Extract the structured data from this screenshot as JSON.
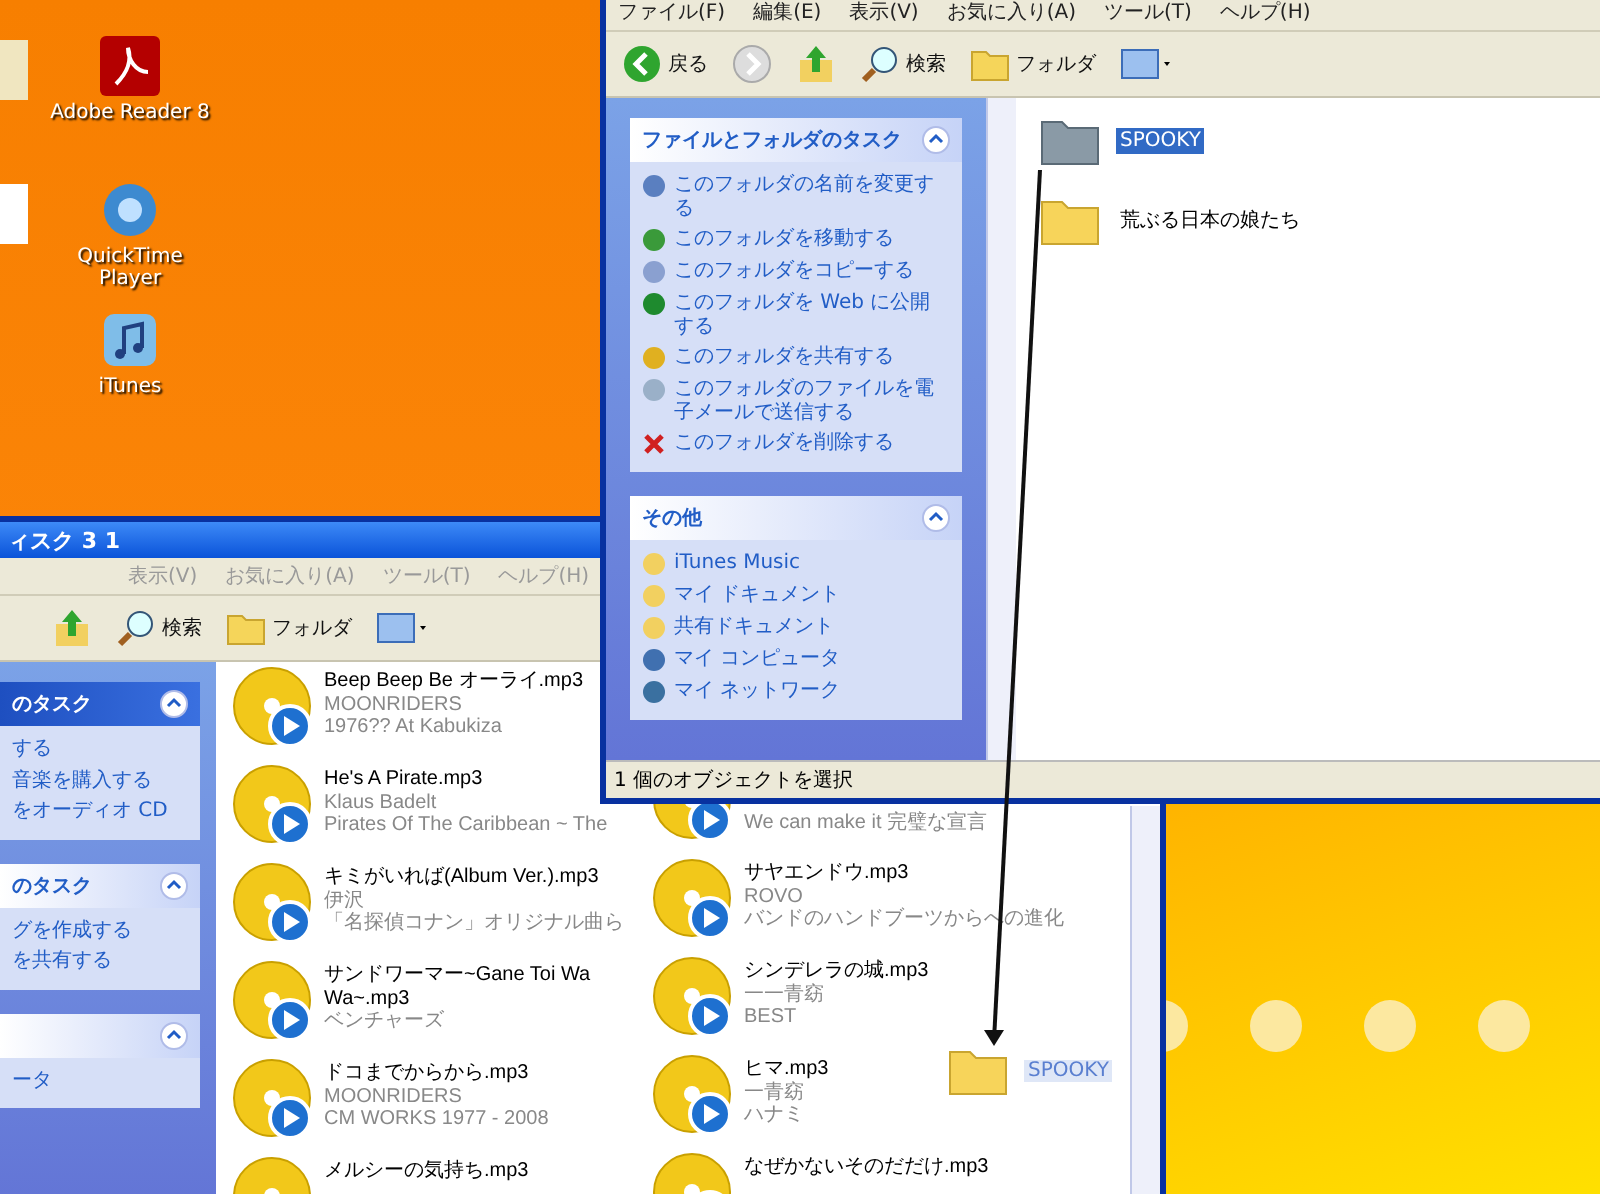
{
  "desktop": {
    "icons": [
      {
        "kind": "pdf",
        "label": "Adobe Reader 8"
      },
      {
        "kind": "quicktime",
        "label": "QuickTime Player"
      },
      {
        "kind": "itunes",
        "label": "iTunes"
      }
    ]
  },
  "front_window": {
    "menu": [
      "ファイル(F)",
      "編集(E)",
      "表示(V)",
      "お気に入り(A)",
      "ツール(T)",
      "ヘルプ(H)"
    ],
    "toolbar": [
      {
        "kind": "back",
        "label": "戻る"
      },
      {
        "kind": "forward"
      },
      {
        "kind": "up"
      },
      {
        "kind": "search",
        "label": "検索"
      },
      {
        "kind": "folders",
        "label": "フォルダ"
      },
      {
        "kind": "views"
      }
    ],
    "panels": [
      {
        "title": "ファイルとフォルダのタスク",
        "items": [
          {
            "kind": "rename",
            "label": "このフォルダの名前を変更する"
          },
          {
            "kind": "move",
            "label": "このフォルダを移動する"
          },
          {
            "kind": "copy",
            "label": "このフォルダをコピーする"
          },
          {
            "kind": "web",
            "label": "このフォルダを Web に公開する"
          },
          {
            "kind": "share",
            "label": "このフォルダを共有する"
          },
          {
            "kind": "mail",
            "label": "このフォルダのファイルを電子メールで送信する"
          },
          {
            "kind": "delete",
            "label": "このフォルダを削除する"
          }
        ]
      },
      {
        "title": "その他",
        "items": [
          {
            "kind": "folder",
            "label": "iTunes Music"
          },
          {
            "kind": "folder",
            "label": "マイ ドキュメント"
          },
          {
            "kind": "folder",
            "label": "共有ドキュメント"
          },
          {
            "kind": "computer",
            "label": "マイ コンピュータ"
          },
          {
            "kind": "network",
            "label": "マイ ネットワーク"
          }
        ]
      }
    ],
    "files": [
      {
        "name": "SPOOKY",
        "selected": true
      },
      {
        "name": "荒ぶる日本の娘たち",
        "selected": false
      }
    ],
    "status": "1 個のオブジェクトを選択"
  },
  "back_window": {
    "title": "ィスク 3 1",
    "menu": [
      "表示(V)",
      "お気に入り(A)",
      "ツール(T)",
      "ヘルプ(H)"
    ],
    "toolbar": [
      {
        "kind": "up"
      },
      {
        "kind": "search",
        "label": "検索"
      },
      {
        "kind": "folders",
        "label": "フォルダ"
      },
      {
        "kind": "views"
      }
    ],
    "panels": [
      {
        "title": "のタスク",
        "items": [
          "する",
          "音楽を購入する",
          "をオーディオ CD"
        ]
      },
      {
        "title": "のタスク",
        "items": [
          "グを作成する",
          "を共有する"
        ]
      },
      {
        "items": [
          "ータ"
        ]
      }
    ],
    "columns": [
      [
        {
          "title": "Beep Beep Be オーライ.mp3",
          "artist": "MOONRIDERS",
          "album": "1976?? At Kabukiza"
        },
        {
          "title": "He's A Pirate.mp3",
          "artist": "Klaus Badelt",
          "album": "Pirates Of The Caribbean ~ The"
        },
        {
          "title": "キミがいれば(Album Ver.).mp3",
          "artist": "伊沢",
          "album": "「名探偵コナン」オリジナル曲ら"
        },
        {
          "title": "サンドワーマー~Gane Toi Wa Wa~.mp3",
          "artist": "ベンチャーズ"
        },
        {
          "title": "ドコまでからから.mp3",
          "artist": "MOONRIDERS",
          "album": "CM WORKS 1977 - 2008"
        },
        {
          "title": "メルシーの気持ち.mp3"
        }
      ],
      [
        {
          "album": "We can make it 完璧な宣言"
        },
        {
          "title": "サヤエンドウ.mp3",
          "artist": "ROVO",
          "album": "バンドのハンドブーツからへの進化"
        },
        {
          "title": "シンデレラの城.mp3",
          "artist": "一一青窈",
          "album": "BEST"
        },
        {
          "title": "ヒマ.mp3",
          "artist": "一青窈",
          "album": "ハナミ"
        },
        {
          "title": "なぜかないそのだだけ.mp3"
        }
      ]
    ]
  },
  "drag": {
    "label": "SPOOKY"
  }
}
